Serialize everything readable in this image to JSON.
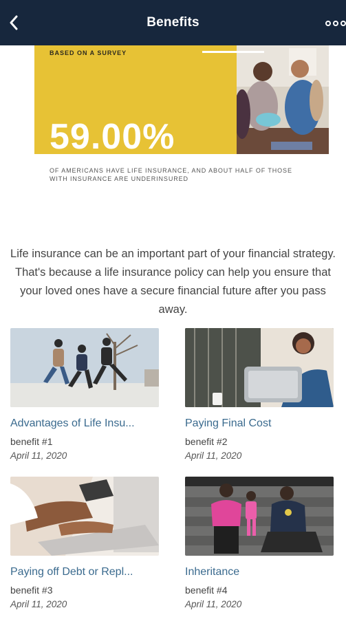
{
  "header": {
    "title": "Benefits",
    "back_icon": "chevron-left-icon",
    "more_icon": "more-dots-icon",
    "background": "#17273d"
  },
  "banner": {
    "survey_label": "BASED ON A SURVEY",
    "stat": "59.00%",
    "caption": "OF AMERICANS HAVE LIFE INSURANCE, AND ABOUT HALF OF THOSE WITH INSURANCE ARE UNDERINSURED",
    "accent": "#e7c235"
  },
  "intro": "Life insurance can be an important part of your financial strategy. That's because a life insurance policy can help you ensure that your loved ones have a secure financial future after you pass away.",
  "cards": [
    {
      "title": "Advantages of Life Insu...",
      "subtitle": "benefit #1",
      "date": "April 11, 2020"
    },
    {
      "title": "Paying Final Cost",
      "subtitle": "benefit #2",
      "date": "April 11, 2020"
    },
    {
      "title": "Paying off Debt or Repl...",
      "subtitle": "benefit #3",
      "date": "April 11, 2020"
    },
    {
      "title": "Inheritance",
      "subtitle": "benefit #4",
      "date": "April 11, 2020"
    }
  ]
}
